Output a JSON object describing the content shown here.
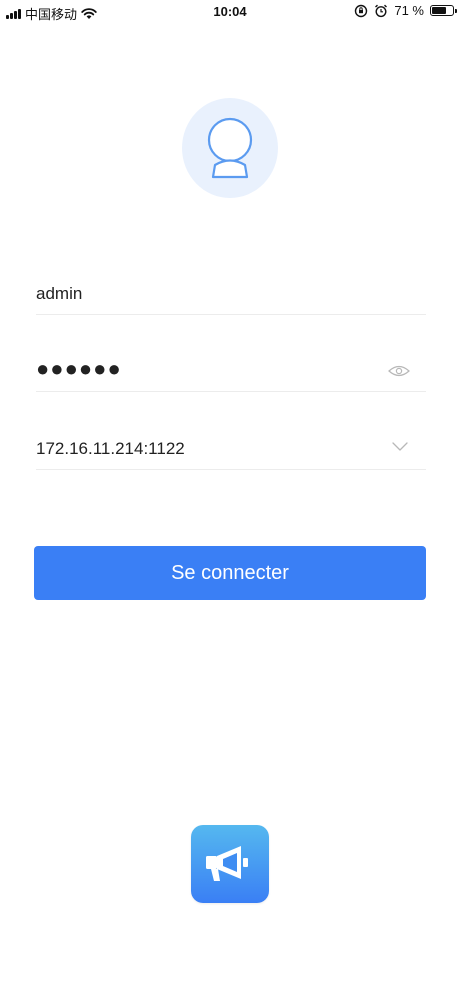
{
  "status_bar": {
    "carrier": "中国移动",
    "time": "10:04",
    "battery_percent": "71 %",
    "battery_level": 0.71
  },
  "login": {
    "username": "admin",
    "password_masked": "●●●●●●",
    "server": "172.16.11.214:1122",
    "submit_label": "Se connecter"
  },
  "icons": {
    "avatar": "user-avatar-icon",
    "eye": "eye-icon",
    "chevron": "chevron-down-icon",
    "app": "megaphone-icon"
  },
  "colors": {
    "accent": "#3a7ff5",
    "avatar_bg": "#e9f1fd",
    "app_gradient_top": "#55b8ef",
    "app_gradient_bottom": "#3a7ff5"
  }
}
